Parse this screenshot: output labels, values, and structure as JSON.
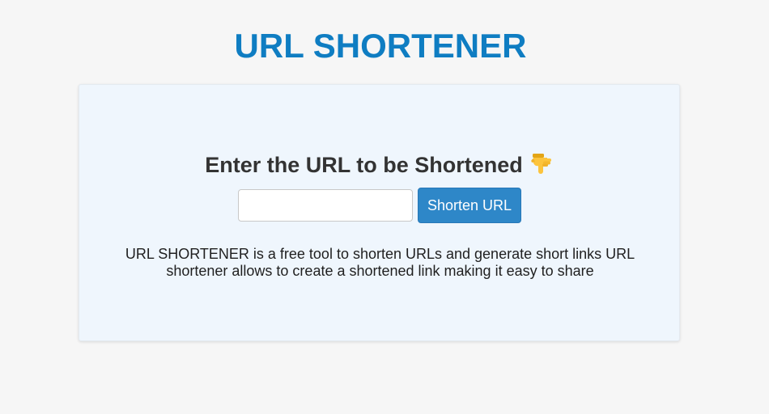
{
  "header": {
    "title": "URL SHORTENER",
    "title_color": "#0f7dc2"
  },
  "card": {
    "background_color": "#eff6fd",
    "prompt": "Enter the URL to be Shortened",
    "prompt_icon": "backhand-index-pointing-down-icon",
    "url_input": {
      "value": "",
      "placeholder": ""
    },
    "submit_label": "Shorten URL",
    "submit_color": "#2e87c8",
    "description": "URL SHORTENER is a free tool to shorten URLs and generate short links URL shortener allows to create a shortened link making it easy to share"
  }
}
